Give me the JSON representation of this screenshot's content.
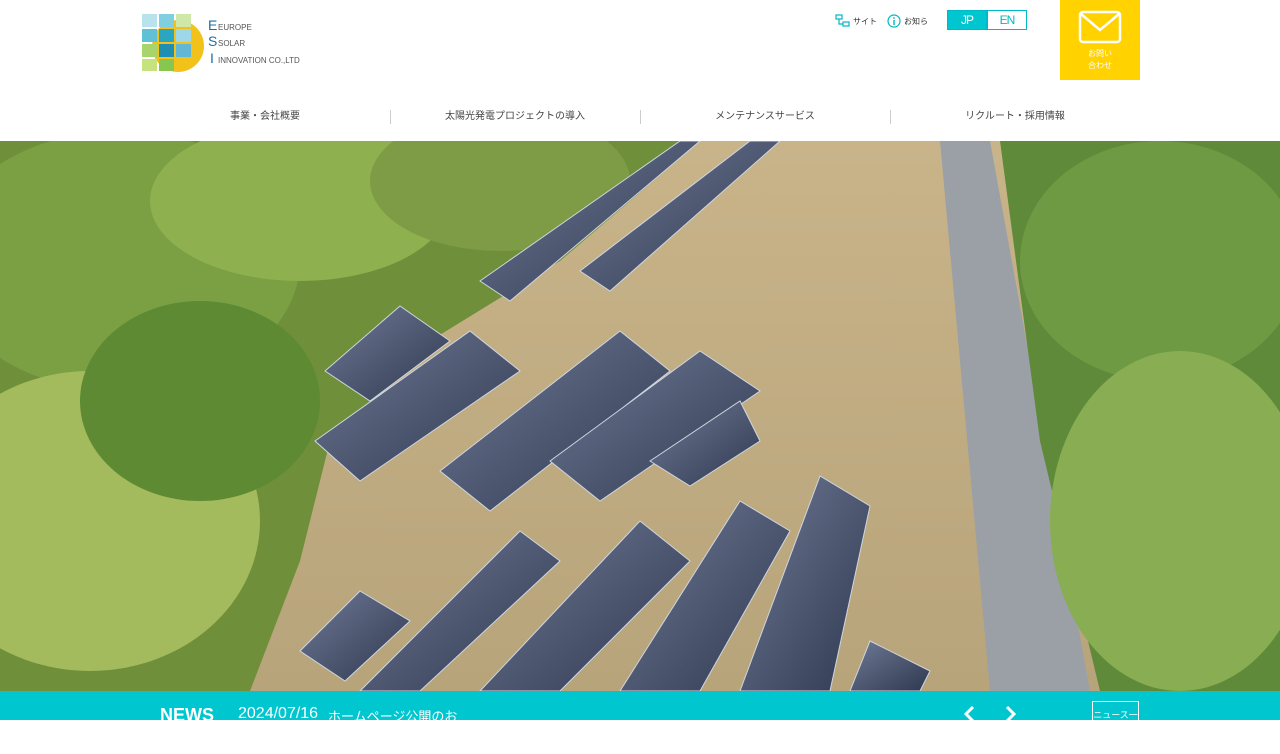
{
  "header": {
    "logo_lines": [
      "EUROPE",
      "SOLAR",
      "INNOVATION CO.,LTD"
    ],
    "sitemap_label": "サイト",
    "info_label": "お知ら",
    "lang": {
      "jp": "JP",
      "en": "EN",
      "active": "jp"
    },
    "contact_label_1": "お問い",
    "contact_label_2": "合わせ"
  },
  "nav": {
    "items": [
      "事業・会社概要",
      "太陽光発電プロジェクトの導入",
      "メンテナンスサービス",
      "リクルート・採用情報"
    ]
  },
  "hero": {
    "image": "aerial view of solar panel array in forest clearing"
  },
  "news": {
    "title": "NEWS",
    "date": "2024/07/16",
    "text": "ホームページ公開のお",
    "list_label": "ニュース一覧"
  },
  "colors": {
    "accent": "#00c6cf",
    "contact": "#ffd200"
  },
  "icons": [
    "sitemap-icon",
    "info-icon",
    "mail-icon",
    "chevron-left-icon",
    "chevron-right-icon"
  ]
}
